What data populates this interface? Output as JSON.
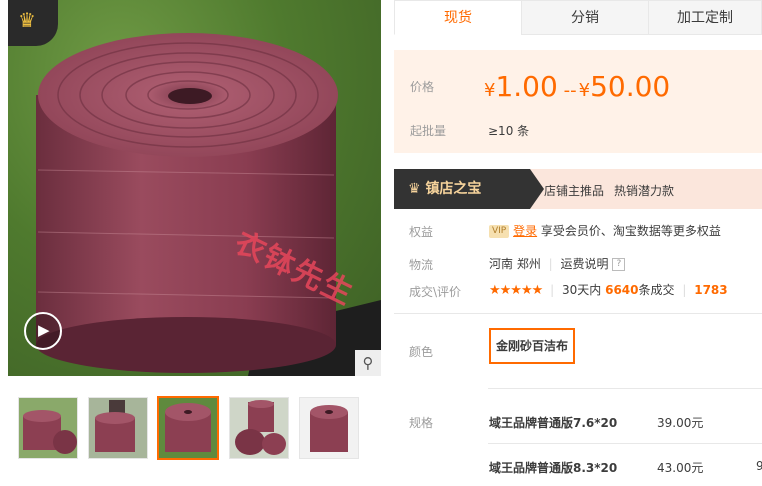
{
  "gallery": {
    "badge_icon": "crown-icon",
    "watermark": "衣钵先生",
    "thumbnails": [
      "thumb-1",
      "thumb-2",
      "thumb-3",
      "thumb-4",
      "thumb-5"
    ],
    "active_thumbnail": 3
  },
  "tabs": [
    {
      "label": "现货",
      "active": true
    },
    {
      "label": "分销",
      "active": false
    },
    {
      "label": "加工定制",
      "active": false
    }
  ],
  "price": {
    "label": "价格",
    "currency": "¥",
    "min": "1.00",
    "separator": "--",
    "max": "50.00",
    "moq_label": "起批量",
    "moq_value": "≥10 条"
  },
  "treasure": {
    "title": "镇店之宝",
    "tags": [
      "店铺主推品",
      "热销潜力款"
    ]
  },
  "benefits": {
    "label": "权益",
    "vip": "VIP",
    "login": "登录",
    "text": "享受会员价、淘宝数据等更多权益"
  },
  "logistics": {
    "label": "物流",
    "origin": "河南  郑州",
    "link": "运费说明"
  },
  "reviews": {
    "label": "成交\\评价",
    "stars": "★★★★★",
    "rating": 4.5,
    "period": "30天内",
    "count": "6640",
    "suffix": "条成交",
    "extra": "1783"
  },
  "color": {
    "label": "颜色",
    "option": "金刚砂百洁布"
  },
  "specs": {
    "label": "规格",
    "rows": [
      {
        "name": "域王品牌普通版7.6*20",
        "price": "39.00元"
      },
      {
        "name": "域王品牌普通版8.3*20",
        "price": "43.00元"
      }
    ],
    "partial": "9"
  },
  "colors": {
    "accent": "#ff6a00",
    "price_bg": "#fff2e8",
    "treasure_bg": "#fbe6dc"
  }
}
